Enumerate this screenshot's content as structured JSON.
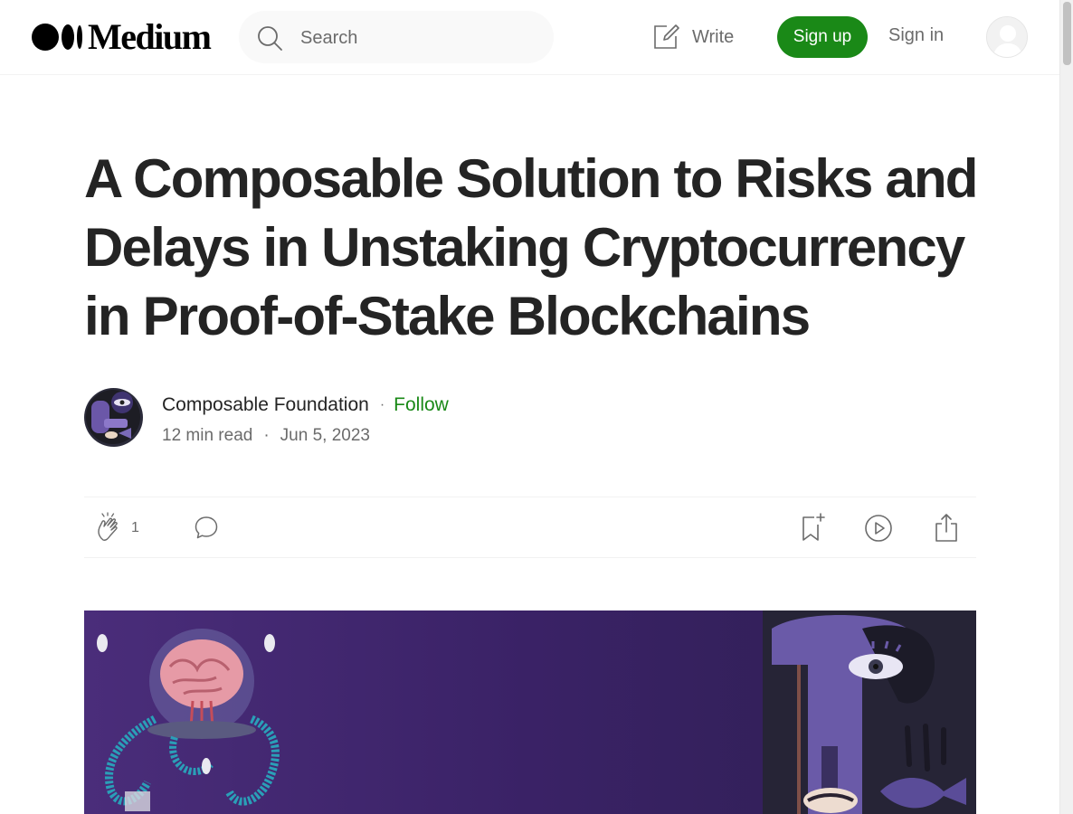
{
  "brand": {
    "name": "Medium"
  },
  "header": {
    "search_placeholder": "Search",
    "write_label": "Write",
    "signup_label": "Sign up",
    "signin_label": "Sign in"
  },
  "article": {
    "title": "A Composable Solution to Risks and Delays in Unstaking Cryptocurrency in Proof-of-Stake Blockchains",
    "author": "Composable Foundation",
    "follow_label": "Follow",
    "separator": "·",
    "read_time": "12 min read",
    "date": "Jun 5, 2023",
    "clap_count": "1"
  },
  "icons": {
    "search": "search-icon",
    "write": "write-icon",
    "clap": "clap-icon",
    "comment": "comment-icon",
    "bookmark": "bookmark-add-icon",
    "listen": "play-icon",
    "share": "share-icon"
  },
  "colors": {
    "accent_green": "#1a8917",
    "text_primary": "#242424",
    "text_secondary": "#6b6b6b",
    "hero_bg": "#3b2466"
  }
}
